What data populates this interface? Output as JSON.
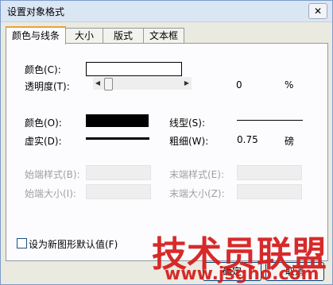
{
  "window": {
    "title": "设置对象格式",
    "close_glyph": "✕"
  },
  "tabs": [
    {
      "label": "颜色与线条"
    },
    {
      "label": "大小"
    },
    {
      "label": "版式"
    },
    {
      "label": "文本框"
    }
  ],
  "fill": {
    "color_label": "颜色(C):",
    "transparency_label": "透明度(T):",
    "transparency_value": "0",
    "transparency_unit": "%",
    "transparency_level": 0
  },
  "line": {
    "color_label": "颜色(O):",
    "dash_label": "虚实(D):",
    "style_label": "线型(S):",
    "weight_label": "粗细(W):",
    "weight_value": "0.75",
    "weight_unit": "磅"
  },
  "arrows": {
    "begin_style_label": "始端样式(B):",
    "begin_size_label": "始端大小(I):",
    "end_style_label": "末端样式(E):",
    "end_size_label": "末端大小(Z):"
  },
  "default_checkbox": {
    "label": "设为新图形默认值(F)",
    "checked": false
  },
  "buttons": {
    "ok": "确定",
    "cancel": "取消"
  },
  "watermark": {
    "text": "技术员联盟",
    "url": "www.jsgho.com"
  },
  "colors": {
    "line_color": "#000000",
    "fill_color": "#ffffff",
    "watermark": "#d61f1f"
  }
}
